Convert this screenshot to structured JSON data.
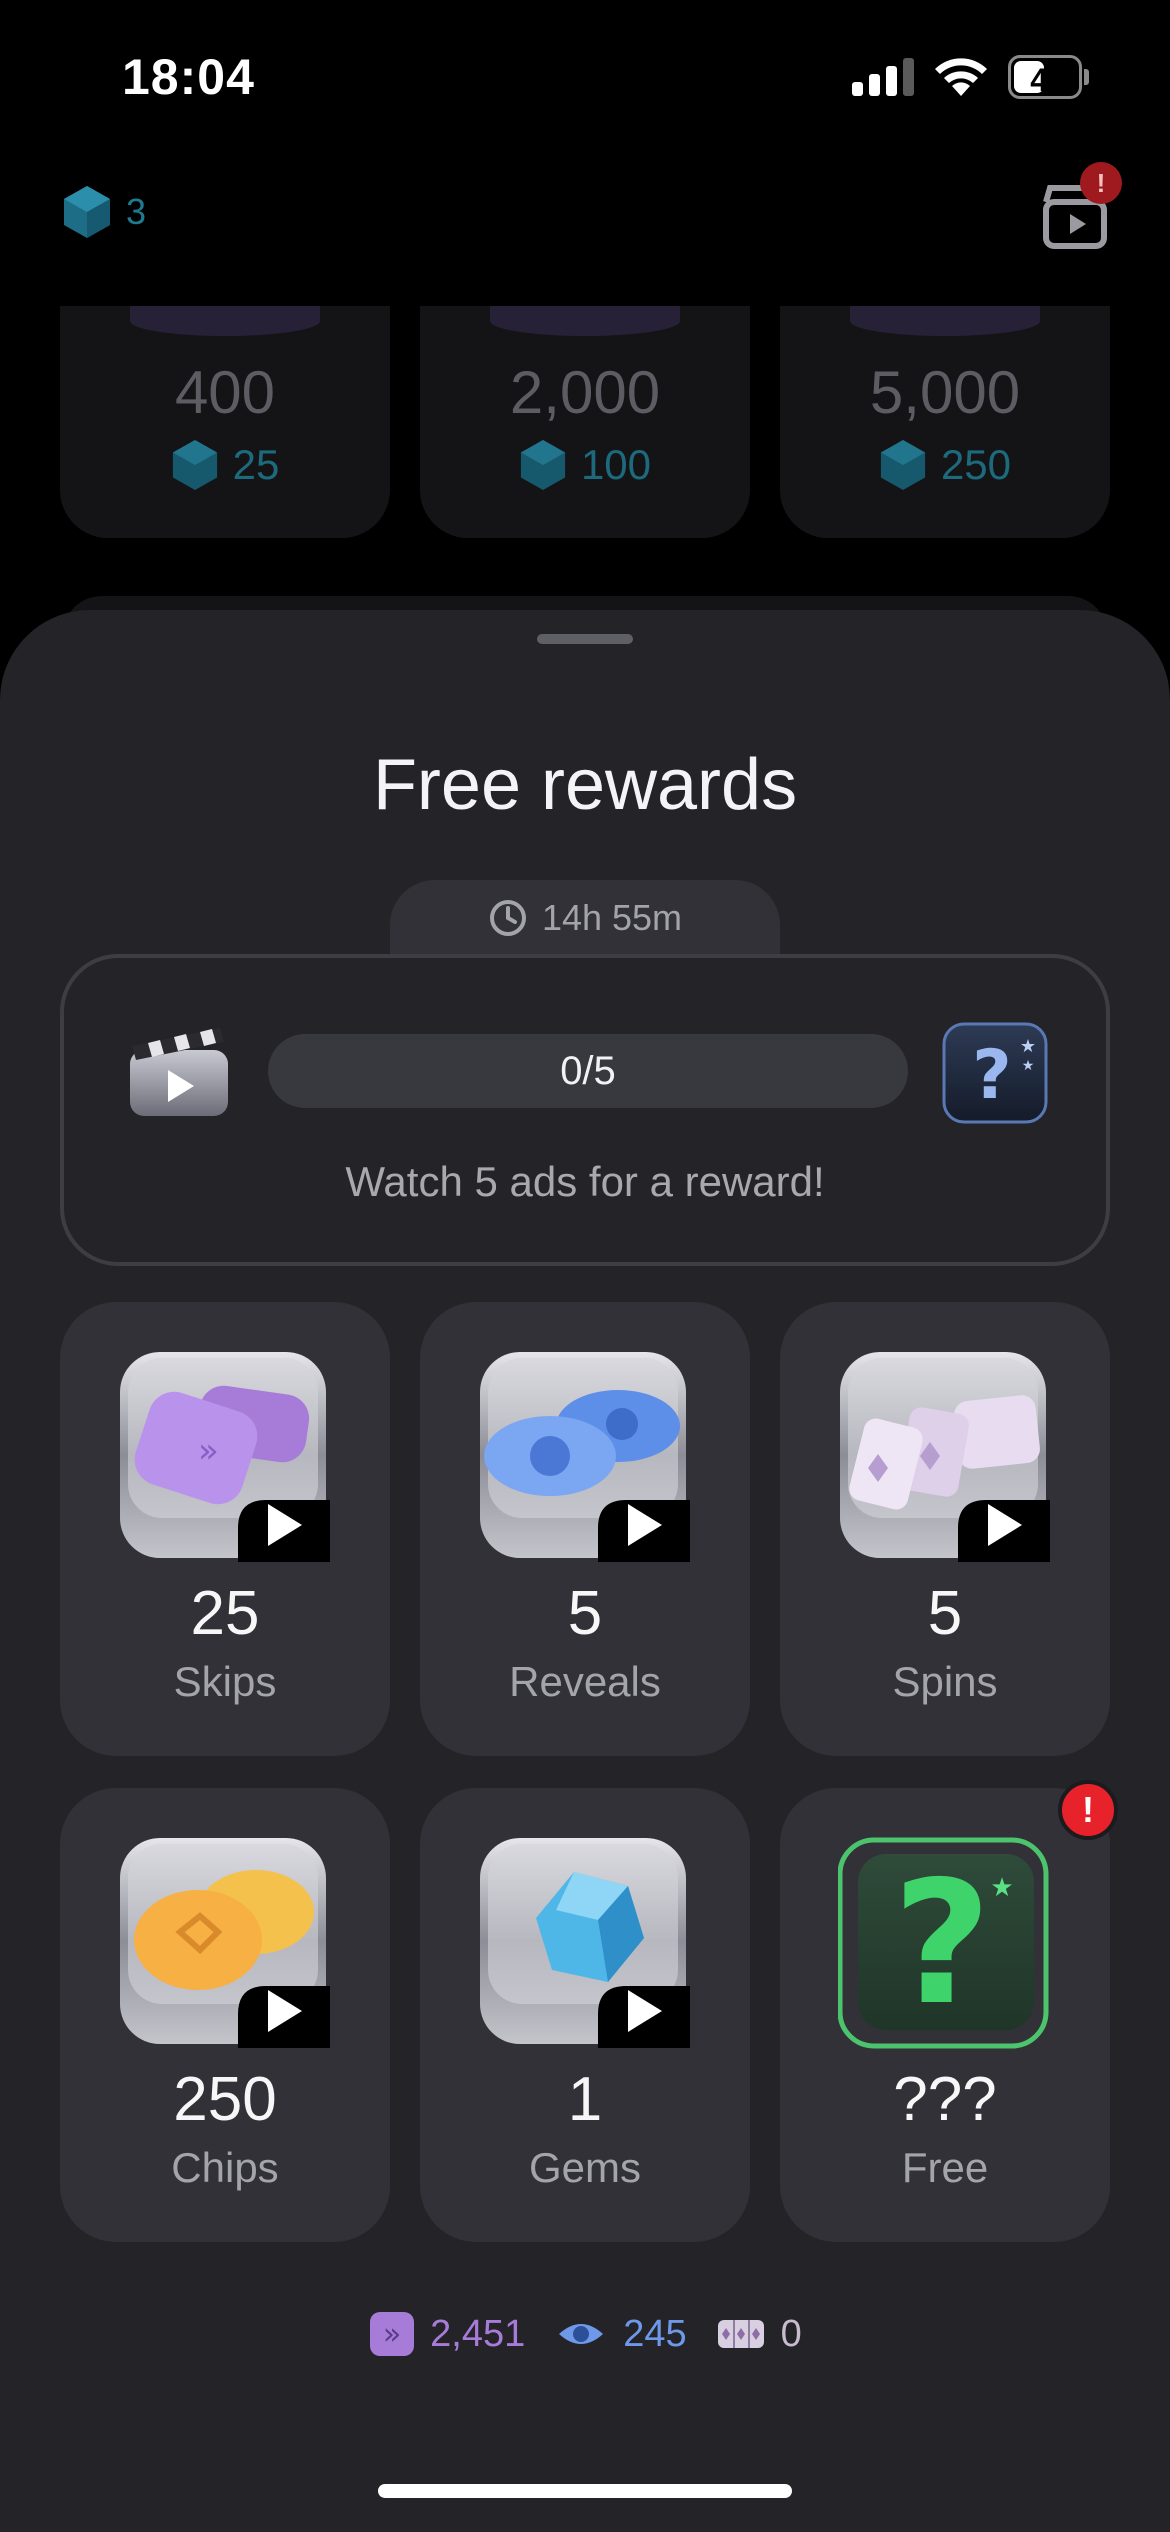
{
  "status_bar": {
    "time": "18:04",
    "battery_level": "45"
  },
  "header": {
    "gem_count": "3",
    "notification_badge": "!"
  },
  "shop": {
    "cards": [
      {
        "amount": "400",
        "price": "25"
      },
      {
        "amount": "2,000",
        "price": "100"
      },
      {
        "amount": "5,000",
        "price": "250"
      }
    ]
  },
  "sheet": {
    "title": "Free rewards",
    "timer": "14h 55m",
    "ads": {
      "progress_label": "0/5",
      "progress_fraction": 0,
      "caption": "Watch 5 ads for a reward!"
    },
    "rewards": [
      {
        "count": "25",
        "label": "Skips",
        "icon": "skip-cards-icon"
      },
      {
        "count": "5",
        "label": "Reveals",
        "icon": "eye-reveal-icon"
      },
      {
        "count": "5",
        "label": "Spins",
        "icon": "slot-reels-icon"
      },
      {
        "count": "250",
        "label": "Chips",
        "icon": "coin-chips-icon"
      },
      {
        "count": "1",
        "label": "Gems",
        "icon": "gem-icon"
      },
      {
        "count": "???",
        "label": "Free",
        "icon": "mystery-question-icon"
      }
    ],
    "free_alert": "!",
    "totals": [
      {
        "value": "2,451",
        "icon": "skip-icon",
        "color": "#a77bd8"
      },
      {
        "value": "245",
        "icon": "eye-icon",
        "color": "#6e98e8"
      },
      {
        "value": "0",
        "icon": "reels-icon",
        "color": "#c7bccd"
      }
    ]
  },
  "colors": {
    "background": "#000000",
    "sheet": "#232328",
    "card": "#313137",
    "alert": "#e8222b",
    "gem": "#1f7a8f"
  }
}
